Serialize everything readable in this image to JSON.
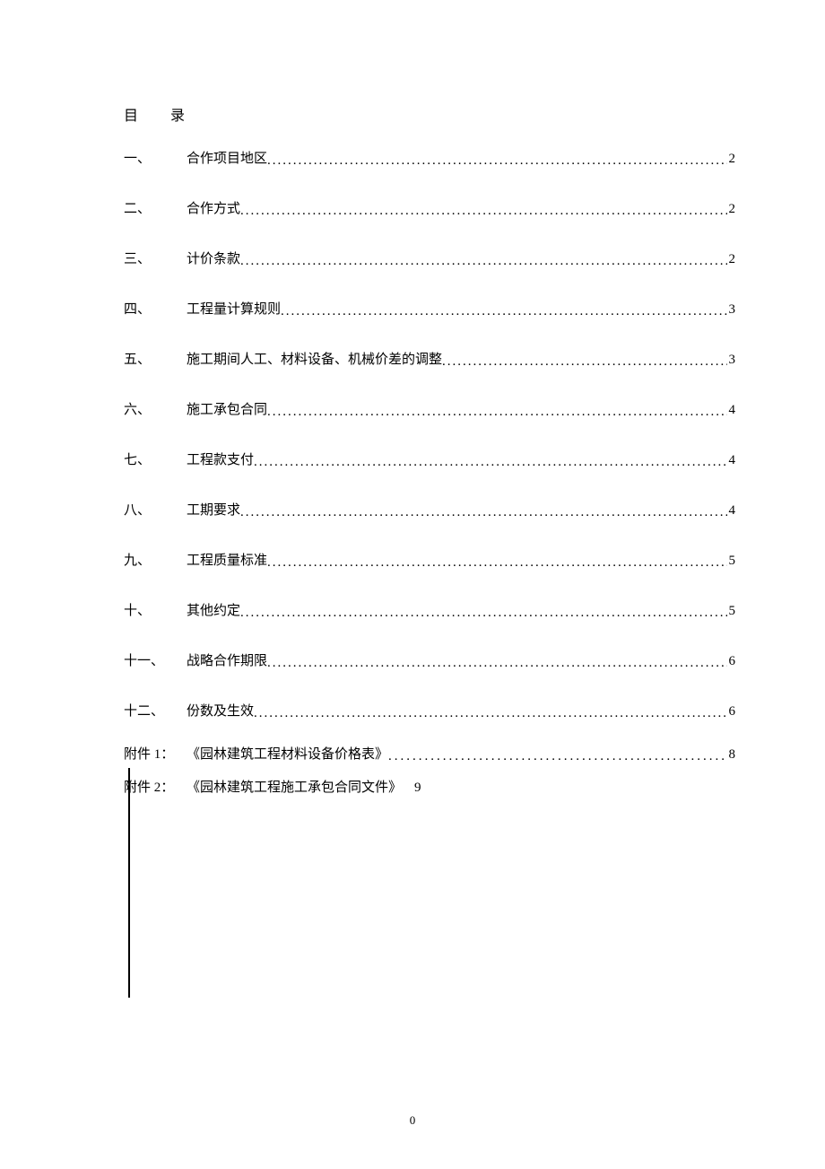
{
  "title": {
    "char1": "目",
    "char2": "录"
  },
  "toc": [
    {
      "num": "一、",
      "text": "合作项目地区",
      "page": "2"
    },
    {
      "num": "二、",
      "text": "合作方式",
      "page": "2"
    },
    {
      "num": "三、",
      "text": "计价条款",
      "page": "2"
    },
    {
      "num": "四、",
      "text": "工程量计算规则",
      "page": "3"
    },
    {
      "num": "五、",
      "text": "施工期间人工、材料设备、机械价差的调整",
      "page": "3"
    },
    {
      "num": "六、",
      "text": "施工承包合同",
      "page": "4"
    },
    {
      "num": "七、",
      "text": "工程款支付",
      "page": "4"
    },
    {
      "num": "八、",
      "text": "工期要求",
      "page": "4"
    },
    {
      "num": "九、",
      "text": "工程质量标准",
      "page": "5"
    },
    {
      "num": "十、",
      "text": "其他约定",
      "page": "5"
    },
    {
      "num": "十一、",
      "text": "战略合作期限",
      "page": "6"
    },
    {
      "num": "十二、",
      "text": "份数及生效",
      "page": "6"
    }
  ],
  "appendix": [
    {
      "num": "附件 1：",
      "text": "《园林建筑工程材料设备价格表》",
      "page": "8",
      "dotted": true
    },
    {
      "num": "附件 2：",
      "text": "《园林建筑工程施工承包合同文件》",
      "page": "9",
      "dotted": false
    }
  ],
  "footer": {
    "page_number": "0"
  }
}
